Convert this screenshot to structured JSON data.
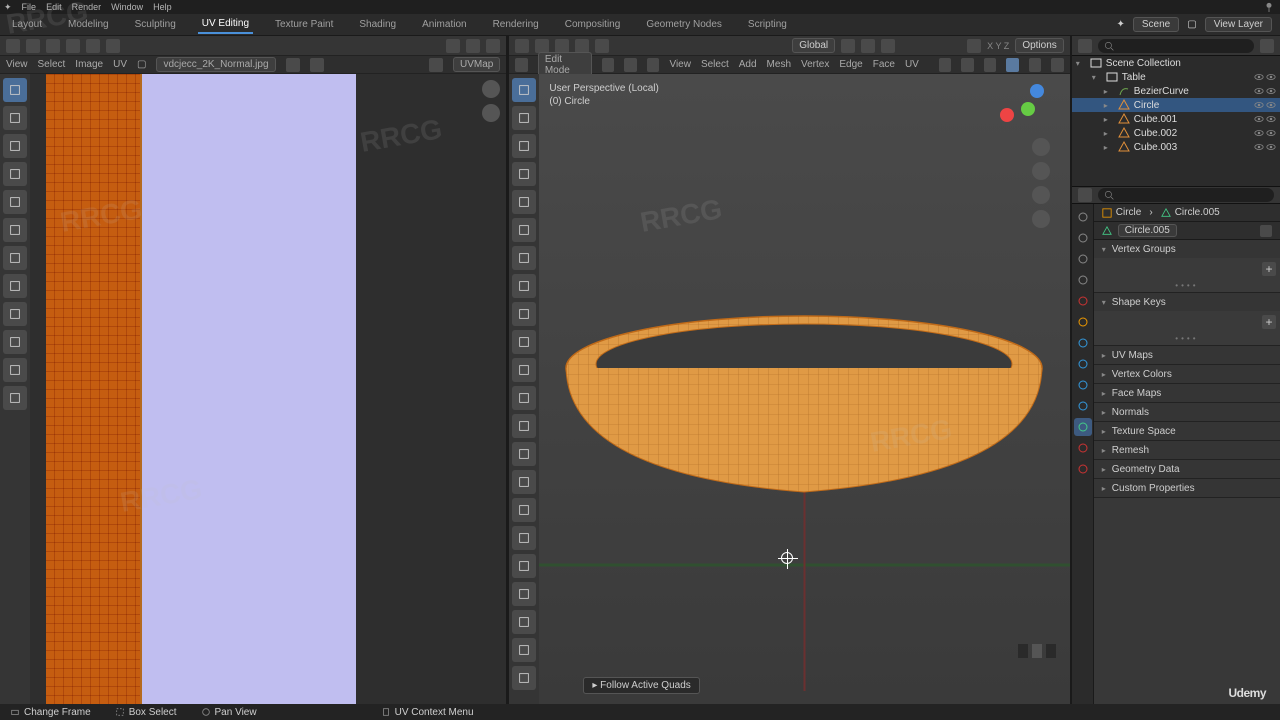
{
  "topMenu": [
    "File",
    "Edit",
    "Render",
    "Window",
    "Help"
  ],
  "workspaces": {
    "tabs": [
      "Layout",
      "Modeling",
      "Sculpting",
      "UV Editing",
      "Texture Paint",
      "Shading",
      "Animation",
      "Rendering",
      "Compositing",
      "Geometry Nodes",
      "Scripting"
    ],
    "active": "UV Editing",
    "scene": "Scene",
    "viewLayer": "View Layer"
  },
  "uvPanel": {
    "headerRight": [
      "Global",
      "Options"
    ],
    "subMenus": [
      "View",
      "Select",
      "Image",
      "UV"
    ],
    "imageName": "vdcjecc_2K_Normal.jpg",
    "uvmap": "UVMap",
    "tools": [
      {
        "name": "tweak-tool",
        "active": true
      },
      {
        "name": "select-box-tool"
      },
      {
        "name": "cursor-tool"
      },
      {
        "name": "move-tool"
      },
      {
        "name": "rotate-tool"
      },
      {
        "name": "scale-tool"
      },
      {
        "name": "transform-tool"
      },
      {
        "name": "annotate-tool"
      },
      {
        "name": "measure-tool"
      },
      {
        "name": "rip-tool"
      },
      {
        "name": "grab-tool"
      },
      {
        "name": "pinch-tool"
      }
    ]
  },
  "viewport": {
    "mode": "Edit Mode",
    "menus": [
      "View",
      "Select",
      "Add",
      "Mesh",
      "Vertex",
      "Edge",
      "Face",
      "UV"
    ],
    "orientation": "Global",
    "options": "Options",
    "info1": "User Perspective (Local)",
    "info2": "(0) Circle",
    "followHint": "Follow Active Quads",
    "tools": [
      {
        "name": "tweak-tool",
        "active": true
      },
      {
        "name": "select-box-tool"
      },
      {
        "name": "cursor-tool"
      },
      {
        "name": "move-tool"
      },
      {
        "name": "rotate-tool"
      },
      {
        "name": "scale-tool"
      },
      {
        "name": "transform-tool"
      },
      {
        "name": "annotate-tool"
      },
      {
        "name": "measure-tool"
      },
      {
        "name": "add-cube-tool"
      },
      {
        "name": "extrude-tool"
      },
      {
        "name": "inset-tool"
      },
      {
        "name": "bevel-tool"
      },
      {
        "name": "loopcut-tool"
      },
      {
        "name": "knife-tool"
      },
      {
        "name": "polybuild-tool"
      },
      {
        "name": "spin-tool"
      },
      {
        "name": "smooth-tool"
      },
      {
        "name": "edge-slide-tool"
      },
      {
        "name": "shrink-tool"
      },
      {
        "name": "shear-tool"
      },
      {
        "name": "rip-region-tool"
      }
    ]
  },
  "outliner": {
    "root": "Scene Collection",
    "items": [
      {
        "label": "Table",
        "type": "collection",
        "indent": 1,
        "expanded": true
      },
      {
        "label": "BezierCurve",
        "type": "curve",
        "indent": 2
      },
      {
        "label": "Circle",
        "type": "mesh",
        "indent": 2,
        "selected": true
      },
      {
        "label": "Cube.001",
        "type": "mesh",
        "indent": 2
      },
      {
        "label": "Cube.002",
        "type": "mesh",
        "indent": 2
      },
      {
        "label": "Cube.003",
        "type": "mesh",
        "indent": 2
      }
    ]
  },
  "properties": {
    "crumbObject": "Circle",
    "crumbData": "Circle.005",
    "dataName": "Circle.005",
    "sections": [
      {
        "label": "Vertex Groups",
        "open": true,
        "body": true
      },
      {
        "label": "Shape Keys",
        "open": true,
        "body": true
      },
      {
        "label": "UV Maps",
        "open": false
      },
      {
        "label": "Vertex Colors",
        "open": false
      },
      {
        "label": "Face Maps",
        "open": false
      },
      {
        "label": "Normals",
        "open": false
      },
      {
        "label": "Texture Space",
        "open": false
      },
      {
        "label": "Remesh",
        "open": false
      },
      {
        "label": "Geometry Data",
        "open": false
      },
      {
        "label": "Custom Properties",
        "open": false
      }
    ],
    "tabs": [
      {
        "name": "render-tab",
        "color": "#888"
      },
      {
        "name": "output-tab",
        "color": "#888"
      },
      {
        "name": "viewlayer-tab",
        "color": "#888"
      },
      {
        "name": "scene-tab",
        "color": "#888"
      },
      {
        "name": "world-tab",
        "color": "#c33"
      },
      {
        "name": "object-tab",
        "color": "#e90"
      },
      {
        "name": "modifier-tab",
        "color": "#39d"
      },
      {
        "name": "particles-tab",
        "color": "#39d"
      },
      {
        "name": "physics-tab",
        "color": "#39d"
      },
      {
        "name": "constraints-tab",
        "color": "#39d"
      },
      {
        "name": "objectdata-tab",
        "color": "#4c8",
        "active": true
      },
      {
        "name": "material-tab",
        "color": "#c33"
      },
      {
        "name": "texture-tab",
        "color": "#c33"
      }
    ]
  },
  "statusbar": {
    "items": [
      "Change Frame",
      "Box Select",
      "Pan View",
      "UV Context Menu"
    ]
  },
  "branding": {
    "udemy": "Udemy",
    "rrcg": "RRCG"
  }
}
